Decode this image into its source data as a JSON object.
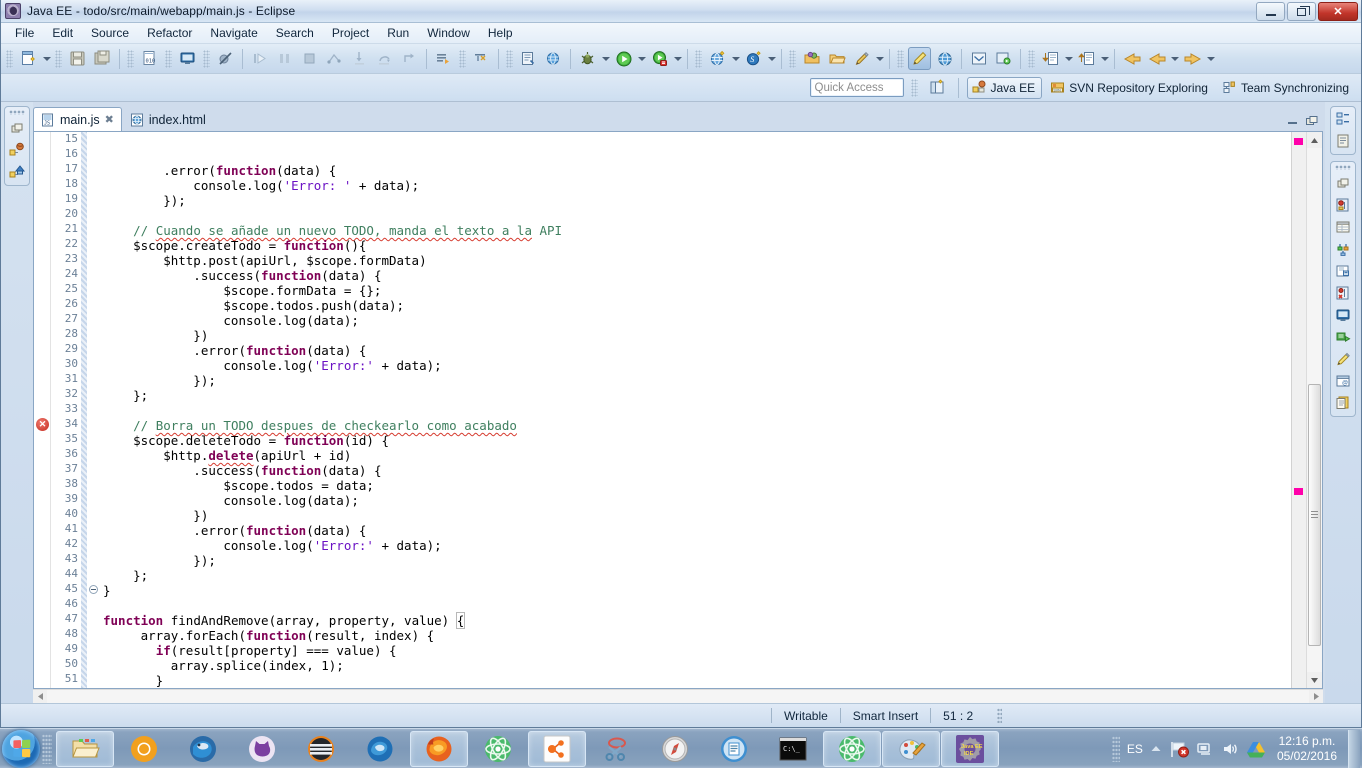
{
  "window": {
    "title": "Java EE - todo/src/main/webapp/main.js - Eclipse",
    "app_icon": "eclipse-icon",
    "controls": {
      "minimize": "Minimize",
      "restore": "Restore",
      "close": "Close"
    }
  },
  "menubar": {
    "items": [
      {
        "label": "File",
        "mnemonic": "F"
      },
      {
        "label": "Edit",
        "mnemonic": "E"
      },
      {
        "label": "Source",
        "mnemonic": "S"
      },
      {
        "label": "Refactor",
        "mnemonic": "t"
      },
      {
        "label": "Navigate",
        "mnemonic": "N"
      },
      {
        "label": "Search",
        "mnemonic": "c"
      },
      {
        "label": "Project",
        "mnemonic": "P"
      },
      {
        "label": "Run",
        "mnemonic": "R"
      },
      {
        "label": "Window",
        "mnemonic": "W"
      },
      {
        "label": "Help",
        "mnemonic": "H"
      }
    ]
  },
  "toolbar": {
    "groups": [
      {
        "icons": [
          "new-wizard-icon",
          "new-wizard-dropdown-icon",
          "save-icon",
          "save-all-icon"
        ]
      },
      {
        "icons": [
          "new-jsp-icon",
          "console-icon",
          "skip-breakpoints-icon"
        ]
      },
      {
        "icons": [
          "resume-icon",
          "suspend-icon",
          "terminate-icon",
          "disconnect-icon",
          "step-into-icon",
          "step-over-icon",
          "step-return-icon"
        ]
      },
      {
        "icons": [
          "next-annotation-icon",
          "previous-annotation-icon"
        ]
      },
      {
        "icons": [
          "open-type-icon",
          "open-web-browser-icon"
        ]
      },
      {
        "icons": [
          "debug-icon",
          "debug-dropdown-icon",
          "run-icon",
          "run-dropdown-icon",
          "coverage-icon",
          "coverage-dropdown-icon"
        ]
      },
      {
        "icons": [
          "new-web-project-icon",
          "web-dropdown-icon",
          "new-svn-icon",
          "svn-dropdown-icon"
        ]
      },
      {
        "icons": [
          "open-task-icon",
          "open-repository-icon",
          "activate-task-icon",
          "task-dropdown-icon"
        ]
      },
      {
        "icons": [
          "pencil-highlight-icon",
          "globe-icon"
        ]
      },
      {
        "icons": [
          "search-icon",
          "open-search-icon"
        ]
      },
      {
        "icons": [
          "import-icon",
          "import-dropdown-icon",
          "export-icon",
          "export-dropdown-icon"
        ]
      },
      {
        "icons": [
          "back-icon",
          "back-dropdown-icon",
          "forward-icon",
          "forward-dropdown-icon"
        ]
      }
    ]
  },
  "perspective_bar": {
    "quick_access_placeholder": "Quick Access",
    "open_perspective_icon": "open-perspective-icon",
    "perspectives": [
      {
        "label": "Java EE",
        "icon": "java-ee-perspective-icon",
        "active": true
      },
      {
        "label": "SVN Repository Exploring",
        "icon": "svn-perspective-icon",
        "active": false
      },
      {
        "label": "Team Synchronizing",
        "icon": "team-sync-perspective-icon",
        "active": false
      }
    ]
  },
  "left_stack": {
    "restore_icon": "restore-view-icon",
    "items": [
      {
        "icon": "project-explorer-icon",
        "name": "project-explorer"
      },
      {
        "icon": "enterprise-explorer-icon",
        "name": "enterprise-explorer"
      }
    ]
  },
  "right_stack": {
    "top": {
      "restore_icon": "restore-view-icon",
      "items": [
        {
          "icon": "outline-icon",
          "name": "outline-view"
        },
        {
          "icon": "task-list-icon",
          "name": "task-list-view"
        }
      ]
    },
    "bottom": {
      "restore_icon": "restore-view-icon",
      "items": [
        {
          "icon": "markers-icon",
          "name": "markers-view"
        },
        {
          "icon": "properties-icon",
          "name": "properties-view"
        },
        {
          "icon": "servers-icon",
          "name": "servers-view"
        },
        {
          "icon": "data-source-explorer-icon",
          "name": "data-source-explorer"
        },
        {
          "icon": "snippets-icon",
          "name": "snippets-view"
        },
        {
          "icon": "problems-icon",
          "name": "problems-view"
        },
        {
          "icon": "console-view-icon",
          "name": "console-view"
        },
        {
          "icon": "progress-icon",
          "name": "progress-view"
        },
        {
          "icon": "highlight-icon",
          "name": "annotations-view"
        },
        {
          "icon": "internal-browser-icon",
          "name": "internal-browser"
        },
        {
          "icon": "history-icon",
          "name": "history-view"
        }
      ]
    }
  },
  "editor": {
    "tabs": [
      {
        "label": "main.js",
        "icon": "js-file-icon",
        "active": true,
        "closable": true
      },
      {
        "label": "index.html",
        "icon": "html-file-icon",
        "active": false,
        "closable": false
      }
    ],
    "tab_tools": [
      "minimize-editor-icon",
      "maximize-editor-icon"
    ],
    "first_line": 15,
    "current_line": 51,
    "error_line": 34,
    "fold_line": 45,
    "lines": [
      {
        "n": 15,
        "tokens": [
          {
            "t": "        .error(",
            "c": ""
          },
          {
            "t": "function",
            "c": "kw"
          },
          {
            "t": "(data) {",
            "c": ""
          }
        ]
      },
      {
        "n": 16,
        "tokens": [
          {
            "t": "            console.log(",
            "c": ""
          },
          {
            "t": "'Error: '",
            "c": "str"
          },
          {
            "t": " + data);",
            "c": ""
          }
        ]
      },
      {
        "n": 17,
        "tokens": [
          {
            "t": "        });",
            "c": ""
          }
        ]
      },
      {
        "n": 18,
        "tokens": [
          {
            "t": "",
            "c": ""
          }
        ]
      },
      {
        "n": 19,
        "tokens": [
          {
            "t": "    // ",
            "c": "cmt"
          },
          {
            "t": "Cuando se añade un nuevo TODO, manda el texto a la",
            "c": "cmt spell"
          },
          {
            "t": " API",
            "c": "cmt"
          }
        ]
      },
      {
        "n": 20,
        "tokens": [
          {
            "t": "    $scope.createTodo = ",
            "c": ""
          },
          {
            "t": "function",
            "c": "kw"
          },
          {
            "t": "(){",
            "c": ""
          }
        ]
      },
      {
        "n": 21,
        "tokens": [
          {
            "t": "        $http.post(apiUrl, $scope.formData)",
            "c": ""
          }
        ]
      },
      {
        "n": 22,
        "tokens": [
          {
            "t": "            .success(",
            "c": ""
          },
          {
            "t": "function",
            "c": "kw"
          },
          {
            "t": "(data) {",
            "c": ""
          }
        ]
      },
      {
        "n": 23,
        "tokens": [
          {
            "t": "                $scope.formData = {};",
            "c": ""
          }
        ]
      },
      {
        "n": 24,
        "tokens": [
          {
            "t": "                $scope.todos.push(data);",
            "c": ""
          }
        ]
      },
      {
        "n": 25,
        "tokens": [
          {
            "t": "                console.log(data);",
            "c": ""
          }
        ]
      },
      {
        "n": 26,
        "tokens": [
          {
            "t": "            })",
            "c": ""
          }
        ]
      },
      {
        "n": 27,
        "tokens": [
          {
            "t": "            .error(",
            "c": ""
          },
          {
            "t": "function",
            "c": "kw"
          },
          {
            "t": "(data) {",
            "c": ""
          }
        ]
      },
      {
        "n": 28,
        "tokens": [
          {
            "t": "                console.log(",
            "c": ""
          },
          {
            "t": "'Error:'",
            "c": "str"
          },
          {
            "t": " + data);",
            "c": ""
          }
        ]
      },
      {
        "n": 29,
        "tokens": [
          {
            "t": "            });",
            "c": ""
          }
        ]
      },
      {
        "n": 30,
        "tokens": [
          {
            "t": "    };",
            "c": ""
          }
        ]
      },
      {
        "n": 31,
        "tokens": [
          {
            "t": "",
            "c": ""
          }
        ]
      },
      {
        "n": 32,
        "tokens": [
          {
            "t": "    // ",
            "c": "cmt"
          },
          {
            "t": "Borra un TODO despues de checkearlo como acabado",
            "c": "cmt spell"
          }
        ]
      },
      {
        "n": 33,
        "tokens": [
          {
            "t": "    $scope.deleteTodo = ",
            "c": ""
          },
          {
            "t": "function",
            "c": "kw"
          },
          {
            "t": "(id) {",
            "c": ""
          }
        ]
      },
      {
        "n": 34,
        "tokens": [
          {
            "t": "        $http.",
            "c": ""
          },
          {
            "t": "delete",
            "c": "kw spell"
          },
          {
            "t": "(apiUrl + id)",
            "c": ""
          }
        ]
      },
      {
        "n": 35,
        "tokens": [
          {
            "t": "            .success(",
            "c": ""
          },
          {
            "t": "function",
            "c": "kw"
          },
          {
            "t": "(data) {",
            "c": ""
          }
        ]
      },
      {
        "n": 36,
        "tokens": [
          {
            "t": "                $scope.todos = data;",
            "c": ""
          }
        ]
      },
      {
        "n": 37,
        "tokens": [
          {
            "t": "                console.log(data);",
            "c": ""
          }
        ]
      },
      {
        "n": 38,
        "tokens": [
          {
            "t": "            })",
            "c": ""
          }
        ]
      },
      {
        "n": 39,
        "tokens": [
          {
            "t": "            .error(",
            "c": ""
          },
          {
            "t": "function",
            "c": "kw"
          },
          {
            "t": "(data) {",
            "c": ""
          }
        ]
      },
      {
        "n": 40,
        "tokens": [
          {
            "t": "                console.log(",
            "c": ""
          },
          {
            "t": "'Error:'",
            "c": "str"
          },
          {
            "t": " + data);",
            "c": ""
          }
        ]
      },
      {
        "n": 41,
        "tokens": [
          {
            "t": "            });",
            "c": ""
          }
        ]
      },
      {
        "n": 42,
        "tokens": [
          {
            "t": "    };",
            "c": ""
          }
        ]
      },
      {
        "n": 43,
        "tokens": [
          {
            "t": "}",
            "c": ""
          }
        ]
      },
      {
        "n": 44,
        "tokens": [
          {
            "t": "",
            "c": ""
          }
        ]
      },
      {
        "n": 45,
        "tokens": [
          {
            "t": "function",
            "c": "kw"
          },
          {
            "t": " findAndRemove(array, property, value) ",
            "c": ""
          },
          {
            "t": "{",
            "c": "brace-hl"
          }
        ]
      },
      {
        "n": 46,
        "tokens": [
          {
            "t": "     array.forEach(",
            "c": ""
          },
          {
            "t": "function",
            "c": "kw"
          },
          {
            "t": "(result, index) {",
            "c": ""
          }
        ]
      },
      {
        "n": 47,
        "tokens": [
          {
            "t": "       ",
            "c": ""
          },
          {
            "t": "if",
            "c": "kw"
          },
          {
            "t": "(result[property] === value) {",
            "c": ""
          }
        ]
      },
      {
        "n": 48,
        "tokens": [
          {
            "t": "         array.splice(index, 1);",
            "c": ""
          }
        ]
      },
      {
        "n": 49,
        "tokens": [
          {
            "t": "       }",
            "c": ""
          }
        ]
      },
      {
        "n": 50,
        "tokens": [
          {
            "t": "     });",
            "c": ""
          }
        ]
      },
      {
        "n": 51,
        "tokens": [
          {
            "t": "}",
            "c": ""
          }
        ]
      }
    ],
    "ruler_marks": [
      {
        "top_pct": 1,
        "color": "#ff00aa"
      },
      {
        "top_pct": 64,
        "color": "#ff00aa"
      }
    ],
    "scrollbar": {
      "thumb_top_pct": 45,
      "thumb_height_pct": 50
    }
  },
  "statusbar": {
    "writable": "Writable",
    "insert_mode": "Smart Insert",
    "cursor_position": "51 : 2"
  },
  "taskbar": {
    "start_label": "Start",
    "items": [
      {
        "name": "file-explorer",
        "icon": "folder-icon",
        "running": true
      },
      {
        "name": "chrome-canary",
        "icon": "chrome-canary-icon",
        "running": false
      },
      {
        "name": "thunderbird",
        "icon": "thunderbird-icon",
        "running": false
      },
      {
        "name": "github-desktop",
        "icon": "cat-icon",
        "running": false
      },
      {
        "name": "dark-app",
        "icon": "striped-circle-icon",
        "running": false
      },
      {
        "name": "firefox-developer",
        "icon": "firefox-blue-icon",
        "running": false
      },
      {
        "name": "firefox",
        "icon": "firefox-orange-icon",
        "running": true
      },
      {
        "name": "atom-pinned",
        "icon": "atom-green-icon",
        "running": false
      },
      {
        "name": "molecule-app",
        "icon": "molecule-icon",
        "running": true
      },
      {
        "name": "snipping-tool",
        "icon": "scissors-icon",
        "running": false
      },
      {
        "name": "compass-app",
        "icon": "compass-icon",
        "running": false
      },
      {
        "name": "notes-app",
        "icon": "blue-document-icon",
        "running": false
      },
      {
        "name": "command-prompt",
        "icon": "cmd-icon",
        "running": false
      },
      {
        "name": "atom-editor",
        "icon": "atom-green-icon",
        "running": true
      },
      {
        "name": "paint",
        "icon": "paint-palette-icon",
        "running": true
      },
      {
        "name": "eclipse-java-ee",
        "icon": "eclipse-gear-icon",
        "running": true
      }
    ],
    "tray": {
      "language": "ES",
      "icons": [
        "show-hidden-icon",
        "action-center-flag-icon",
        "network-icon",
        "volume-icon",
        "google-drive-icon"
      ],
      "time": "12:16 p.m.",
      "date": "05/02/2016"
    }
  },
  "colors": {
    "keyword": "#7f0055",
    "string": "#6a11c4",
    "comment": "#3f7f5f",
    "spell_underline": "#d63b2f",
    "accent": "#3a6ea5"
  }
}
